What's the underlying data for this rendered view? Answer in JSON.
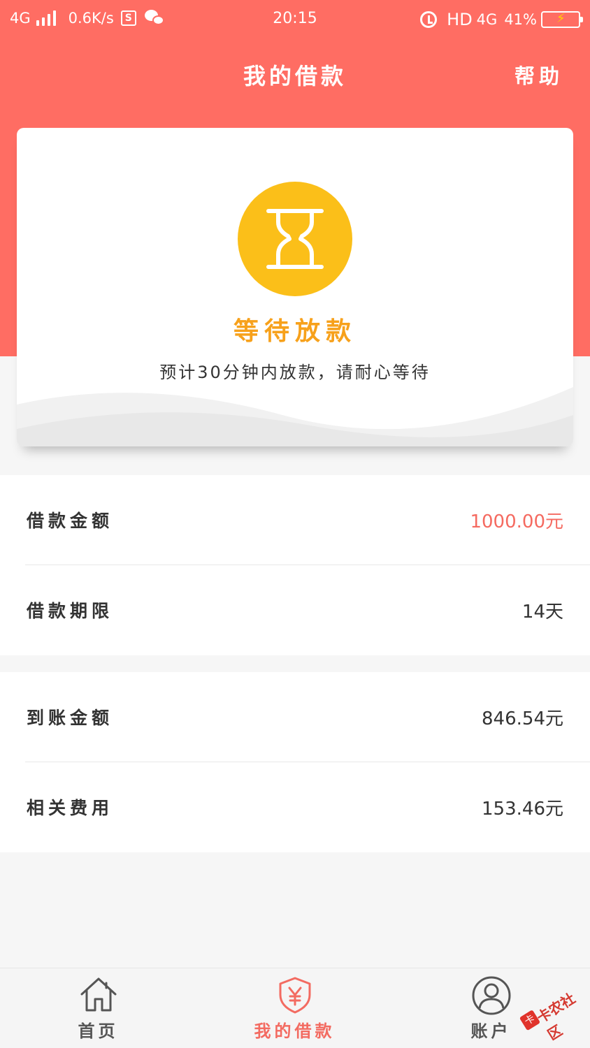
{
  "status_bar": {
    "network": "4G",
    "speed": "0.6K/s",
    "s_icon": "S",
    "time": "20:15",
    "hd": "HD",
    "net2": "4G",
    "battery": "41%"
  },
  "header": {
    "title": "我的借款",
    "help": "帮助",
    "bg_color": "#ff6d63"
  },
  "status_card": {
    "icon": "hourglass-icon",
    "title": "等待放款",
    "description": "预计30分钟内放款，请耐心等待",
    "title_color": "#f7a11b",
    "icon_bg": "#fbbf19"
  },
  "loan_info": [
    {
      "label": "借款金额",
      "value": "1000.00元",
      "accent": true
    },
    {
      "label": "借款期限",
      "value": "14天",
      "accent": false
    }
  ],
  "payout_info": [
    {
      "label": "到账金额",
      "value": "846.54元"
    },
    {
      "label": "相关费用",
      "value": "153.46元"
    }
  ],
  "tabs": [
    {
      "label": "首页",
      "icon": "home-icon",
      "active": false
    },
    {
      "label": "我的借款",
      "icon": "shield-yen-icon",
      "active": true
    },
    {
      "label": "账户",
      "icon": "user-icon",
      "active": false
    }
  ],
  "watermark": {
    "text": "卡农社区",
    "stamp": "卡"
  },
  "accent_color": "#f36b61"
}
